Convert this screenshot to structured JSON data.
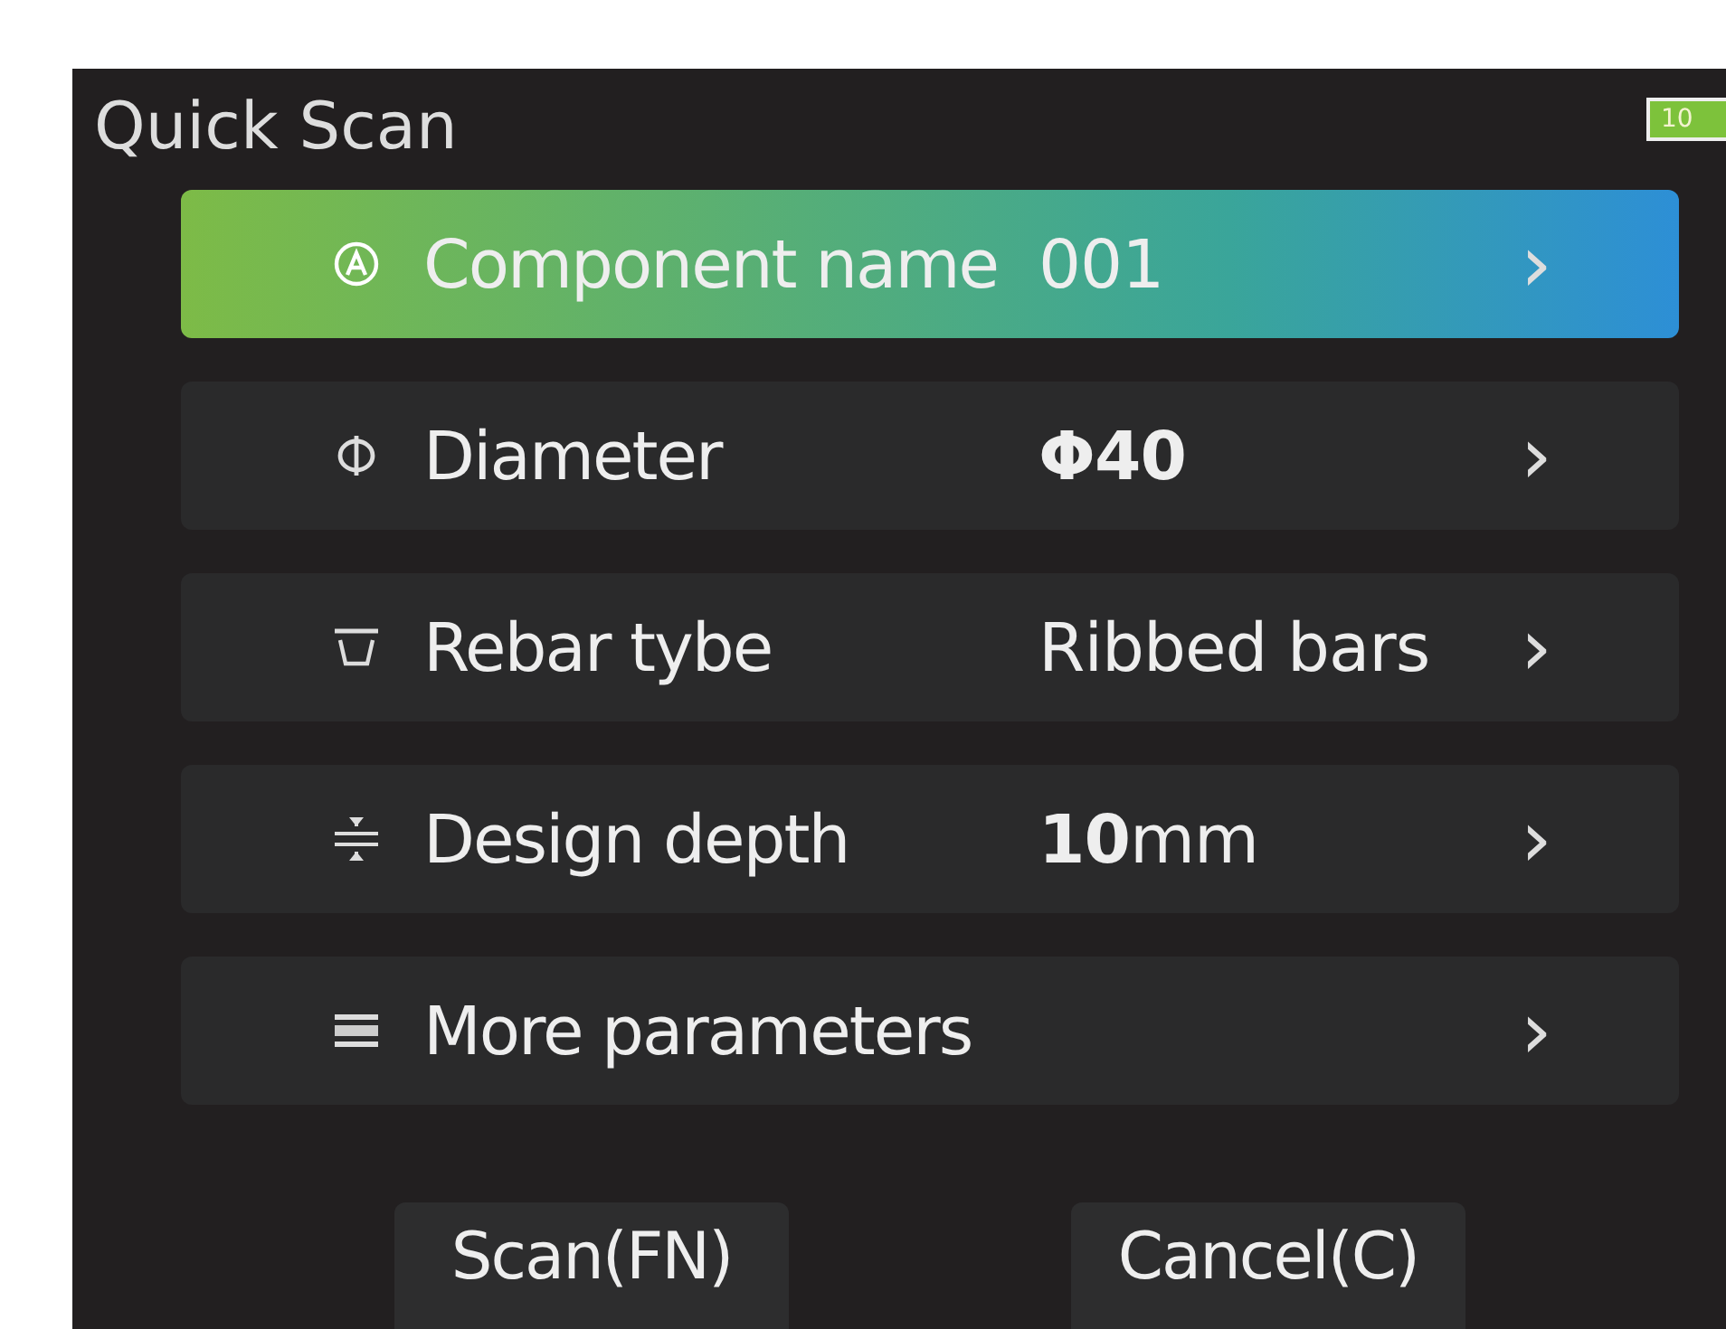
{
  "window": {
    "title": "Quick Scan"
  },
  "battery": {
    "level": 1,
    "text": "10"
  },
  "rows": [
    {
      "kind": "name",
      "label": "Component name",
      "value": "001",
      "selected": true
    },
    {
      "kind": "diameter",
      "label": "Diameter",
      "value": "**Φ40**",
      "selected": false
    },
    {
      "kind": "type",
      "label": "Rebar tybe",
      "value": "Ribbed bars",
      "selected": false
    },
    {
      "kind": "depth",
      "label": "Design depth",
      "value": "**10**mm",
      "selected": false
    },
    {
      "kind": "more",
      "label": "More parameters",
      "selected": false,
      "chevron": "›"
    }
  ],
  "chevron": "›",
  "buttons": [
    "Scan(FN)",
    "Cancel(C)"
  ]
}
